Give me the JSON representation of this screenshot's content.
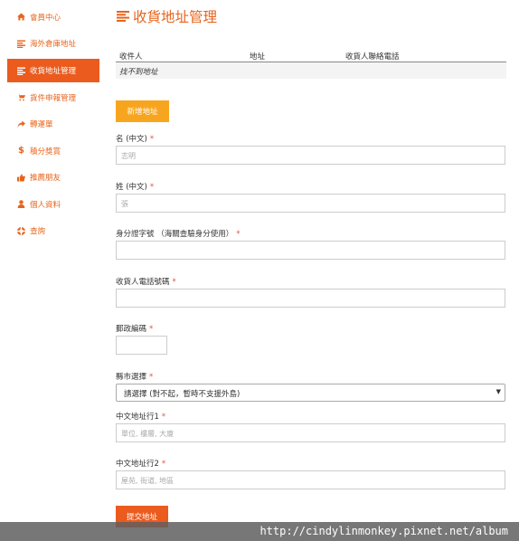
{
  "sidebar": {
    "items": [
      {
        "label": "會員中心",
        "icon": "home-icon"
      },
      {
        "label": "海外倉庫地址",
        "icon": "list-icon"
      },
      {
        "label": "收貨地址管理",
        "icon": "list-icon",
        "active": true
      },
      {
        "label": "貨件申報管理",
        "icon": "cart-icon"
      },
      {
        "label": "轉運單",
        "icon": "share-arrow-icon"
      },
      {
        "label": "積分獎賞",
        "icon": "dollar-icon"
      },
      {
        "label": "推薦朋友",
        "icon": "thumbs-up-icon"
      },
      {
        "label": "個人資料",
        "icon": "user-icon"
      },
      {
        "label": "查詢",
        "icon": "lifebuoy-icon"
      }
    ]
  },
  "header": {
    "title": "收貨地址管理",
    "icon": "list-icon"
  },
  "address_table": {
    "columns": [
      "收件人",
      "地址",
      "收貨人聯絡電話"
    ],
    "empty_message": "找不到地址"
  },
  "add_button": {
    "label": "新增地址"
  },
  "form": {
    "first_name": {
      "label": "名 (中文)",
      "required": "*",
      "placeholder": "志明"
    },
    "last_name": {
      "label": "姓 (中文)",
      "required": "*",
      "placeholder": "張"
    },
    "id_number": {
      "label": "身分證字號 （海關查驗身分使用）",
      "required": "*",
      "placeholder": ""
    },
    "phone": {
      "label": "收貨人電話號碼",
      "required": "*",
      "placeholder": ""
    },
    "zip": {
      "label": "郵政編碼",
      "required": "*",
      "placeholder": ""
    },
    "city": {
      "label": "縣市選擇",
      "required": "*",
      "selected": "請選擇 (對不起，暫時不支援外島)"
    },
    "address1": {
      "label": "中文地址行1",
      "required": "*",
      "placeholder": "單位, 樓層, 大廈"
    },
    "address2": {
      "label": "中文地址行2",
      "required": "*",
      "placeholder": "屋苑, 街道, 地區"
    }
  },
  "submit_button": {
    "label": "提交地址"
  },
  "watermark": "http://cindylinmonkey.pixnet.net/album",
  "colors": {
    "accent": "#ea5b1d",
    "add_button": "#f7a51f",
    "required": "#d9534f"
  }
}
